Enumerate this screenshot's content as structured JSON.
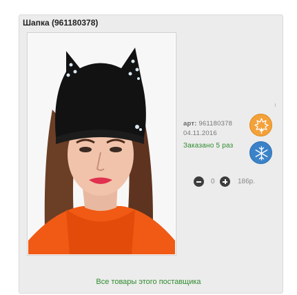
{
  "product": {
    "title": "Шапка (961180378)",
    "image_alt": "Шапка",
    "article": "961180378",
    "article_prefix": "арт:",
    "date": "04.11.2016",
    "ordered_text": "Заказано 5 раз",
    "seasons": [
      "autumn-leaf-icon",
      "winter-snowflake-icon"
    ],
    "quantity": "0",
    "price": "186р."
  },
  "links": {
    "supplier_all": "Все товары этого поставщика"
  },
  "colors": {
    "autumn": "#f3a13a",
    "winter": "#3b83c9",
    "link_green": "#2f8a2f"
  }
}
